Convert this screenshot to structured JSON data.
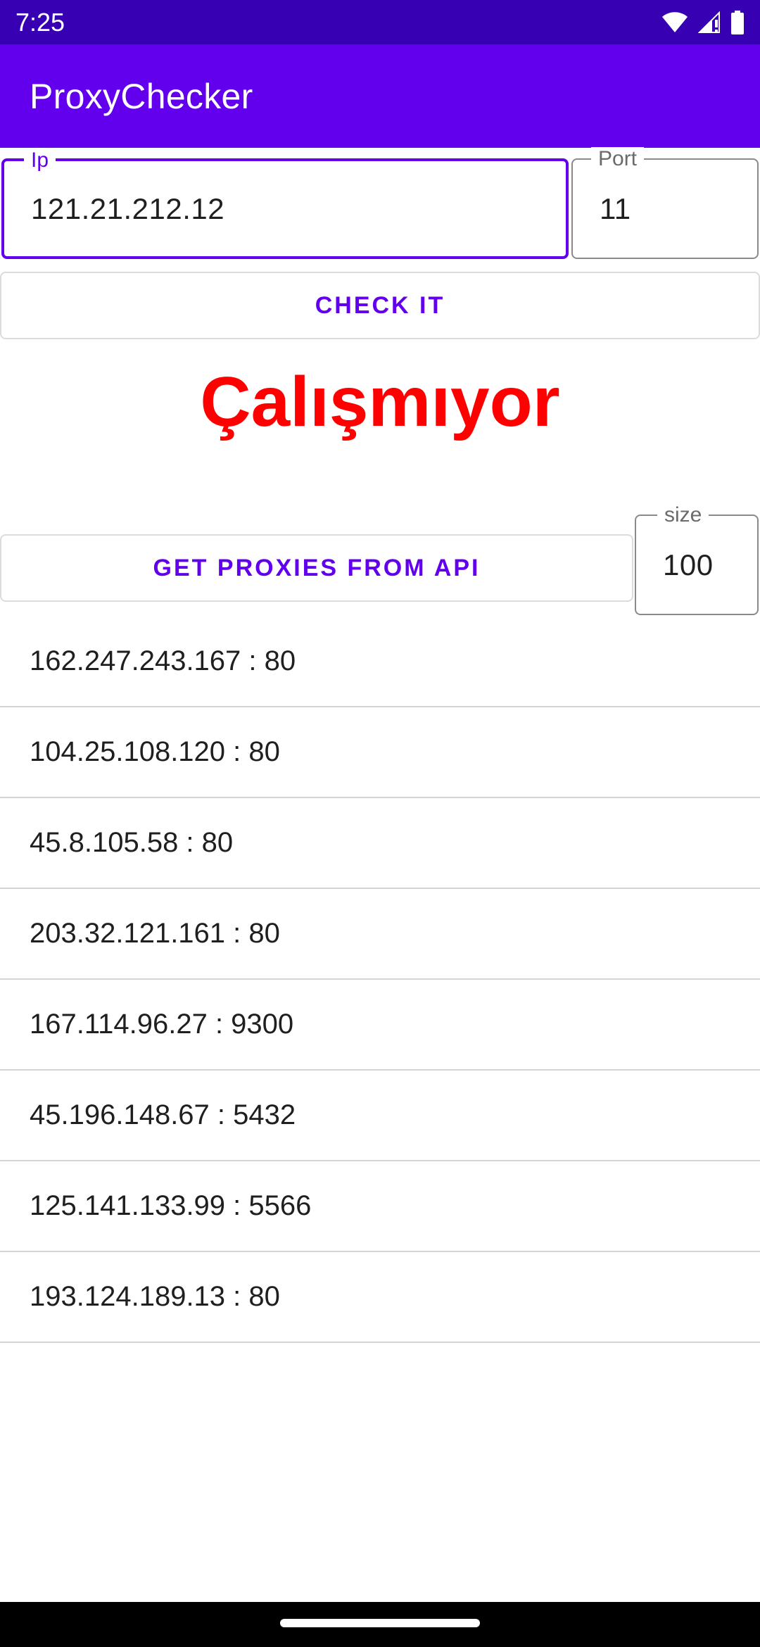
{
  "status_bar": {
    "time": "7:25",
    "icons": [
      "wifi-icon",
      "signal-icon",
      "battery-icon"
    ]
  },
  "app_bar": {
    "title": "ProxyChecker"
  },
  "form": {
    "ip_label": "Ip",
    "ip_value": "121.21.212.12",
    "port_label": "Port",
    "port_value": "11",
    "check_button": "CHECK IT",
    "result_text": "Çalışmıyor",
    "api_button": "GET PROXIES FROM API",
    "size_label": "size",
    "size_value": "100"
  },
  "proxies": [
    {
      "text": "162.247.243.167 : 80"
    },
    {
      "text": "104.25.108.120 : 80"
    },
    {
      "text": "45.8.105.58 : 80"
    },
    {
      "text": "203.32.121.161 : 80"
    },
    {
      "text": "167.114.96.27 : 9300"
    },
    {
      "text": "45.196.148.67 : 5432"
    },
    {
      "text": "125.141.133.99 : 5566"
    },
    {
      "text": "193.124.189.13 : 80"
    }
  ],
  "colors": {
    "status_bar": "#3700b3",
    "primary": "#6200ee",
    "result": "#ff0000"
  }
}
